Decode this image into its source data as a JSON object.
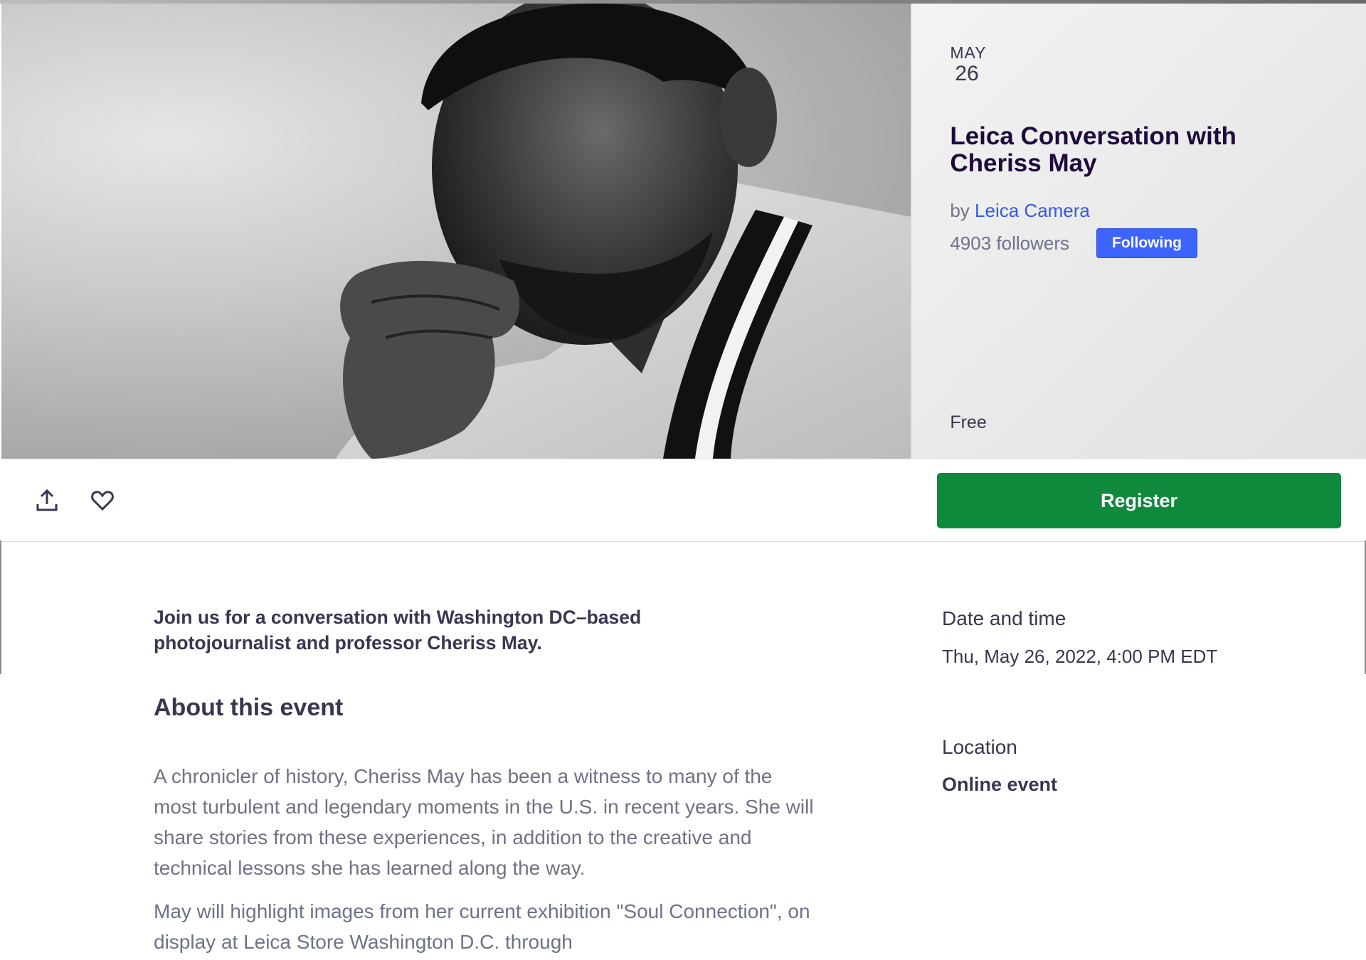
{
  "event": {
    "date_month": "MAY",
    "date_day": "26",
    "title": "Leica Conversation with Cheriss May",
    "organizer_prefix": "by",
    "organizer_name": "Leica Camera",
    "followers": "4903 followers",
    "follow_label": "Following",
    "price": "Free"
  },
  "actions": {
    "share_icon": "share-icon",
    "like_icon": "heart-icon",
    "register_label": "Register"
  },
  "content": {
    "summary": "Join us for a conversation with Washington DC–based photojournalist and professor Cheriss May.",
    "about_heading": "About this event",
    "paragraph_1": "A chronicler of history, Cheriss May has been a witness to many of the most turbulent and legendary moments in the U.S. in recent years. She will share stories from these experiences, in addition to the creative and technical lessons she has learned along the way.",
    "paragraph_2": "May will highlight images from her current exhibition \"Soul Connection\", on display at Leica Store Washington D.C. through"
  },
  "sidebar": {
    "date_time_label": "Date and time",
    "date_time_value": "Thu, May 26, 2022, 4:00 PM EDT",
    "location_label": "Location",
    "location_value": "Online event"
  },
  "colors": {
    "register": "#0f8a3d",
    "follow": "#3d64ff",
    "link": "#3659e3",
    "title": "#1e0a3c"
  }
}
